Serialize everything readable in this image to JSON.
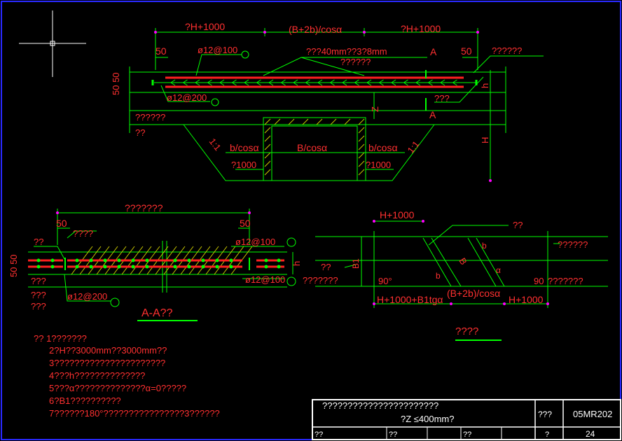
{
  "colors": {
    "background": "#000000",
    "frame": "#2a2aff",
    "lines": "#00ff00",
    "dims": "#ff00ff",
    "rebar": "#ff2020",
    "text": "#ff3030",
    "white": "#ffffff",
    "hatch": "#c8c800"
  },
  "top_view": {
    "dim_left": "?H+1000",
    "dim_mid": "(B+2b)/cosα",
    "dim_right": "?H+1000",
    "d50_left": "50",
    "d50_right": "50",
    "rebar_top": "ø12@100",
    "note_40": "???40mm??3?8mm",
    "note_top_right": "??????",
    "note_sub": "??????",
    "rebar_bottom": "ø12@200",
    "sec_top": "A",
    "sec_bot": "A",
    "left_5050": "50 50",
    "lbl_qqq": "???",
    "lbl_z": "Z",
    "lbl_h": "h",
    "lbl_H": "H",
    "lbl_6q": "??????",
    "lbl_2q": "??",
    "slope_l": "1:1",
    "slope_r": "1:1",
    "bcos_l": "b/cosα",
    "Bcos": "B/cosα",
    "bcos_r": "b/cosα",
    "d1000_l": "?1000",
    "d1000_r": "?1000"
  },
  "section_view": {
    "dim_top": "???????",
    "d50_l": "50",
    "d50_r": "50",
    "lbl_4q": "????",
    "lbl_2q": "??",
    "rebar_r1": "ø12@100",
    "rebar_r2": "ø12@100",
    "rebar_bot": "ø12@200",
    "left_5050": "50 50",
    "lbl_h": "h",
    "left_a": "??",
    "left_b": "???",
    "left_c": "???",
    "left_d": "???????",
    "title": "A-A??"
  },
  "plan_view": {
    "dim_top": "H+1000",
    "lbl_2q": "??",
    "lbl_6q": "??????",
    "lbl_lefta": "??",
    "lbl_B1": "B1",
    "lbl_B": "B",
    "lbl_b1": "b",
    "lbl_b2": "b",
    "lbl_alpha": "α",
    "lbl_90a": "90°",
    "lbl_90b": "90",
    "lbl_7q": "???????",
    "dim_bottom_left": "H+1000+B1tgα",
    "dim_bottom_mid": "(B+2b)/cosα",
    "dim_bottom_right": "H+1000",
    "title": "????"
  },
  "notes": [
    "?? 1???????",
    "2?H??3000mm??3000mm??",
    "3??????????????????????",
    "4???h??????????????",
    "5???α??????????????α=0?????",
    "6?B1??????????",
    "7??????180°????????????????3??????"
  ],
  "title_block": {
    "title1": "???????????????????????",
    "title2": "?Z ≤400mm?",
    "cell_a": "???",
    "code": "05MR202",
    "r2c1": "??",
    "r2c2": "??",
    "r2c3": "??",
    "r2c4": "?",
    "page": "24"
  }
}
